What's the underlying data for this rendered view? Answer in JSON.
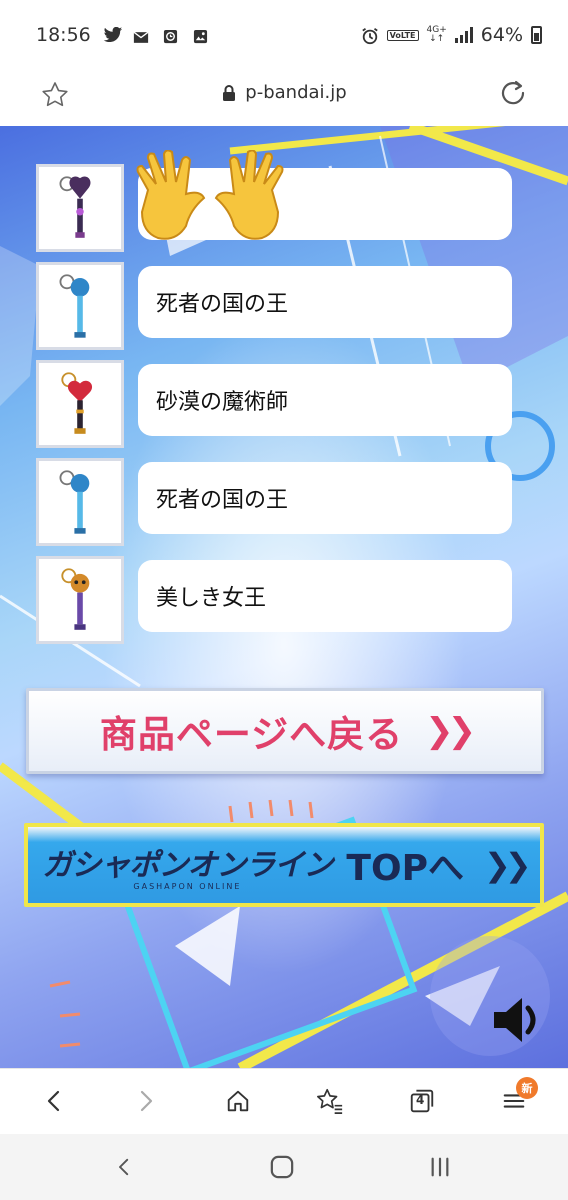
{
  "status_bar": {
    "time": "18:56",
    "volte": "VoLTE",
    "network": "4G+",
    "battery": "64%"
  },
  "url_bar": {
    "domain": "p-bandai.jp"
  },
  "items": [
    {
      "label": "",
      "image": "purple-charm-stick"
    },
    {
      "label": "死者の国の王",
      "image": "blue-charm-stick"
    },
    {
      "label": "砂漠の魔術師",
      "image": "red-heart-charm-stick"
    },
    {
      "label": "死者の国の王",
      "image": "blue-charm-stick"
    },
    {
      "label": "美しき女王",
      "image": "skull-charm-stick"
    }
  ],
  "overlay": {
    "emoji": "raised-hands"
  },
  "buttons": {
    "back_label": "商品ページへ戻る",
    "back_chevrons": "❯❯",
    "logo_text": "ガシャポンオンライン",
    "logo_sub": "GASHAPON ONLINE",
    "top_label": "TOPへ",
    "top_chevrons": "❯❯"
  },
  "browser_nav": {
    "tab_count": "4",
    "menu_badge": "新"
  },
  "colors": {
    "accent_pink": "#e0406a",
    "navy": "#1a2a55",
    "badge_orange": "#f07a2b",
    "yellow": "#f0e64a"
  }
}
